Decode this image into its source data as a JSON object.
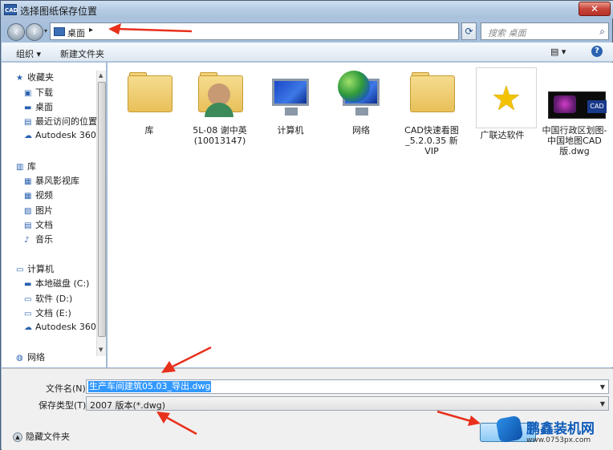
{
  "window": {
    "title": "选择图纸保存位置",
    "app_badge": "CAD",
    "close_label": "✕"
  },
  "address_bar": {
    "location": "桌面",
    "chevron": "▸",
    "search_placeholder": "搜索 桌面"
  },
  "toolbar": {
    "organize_label": "组织 ▾",
    "new_folder_label": "新建文件夹",
    "view_label": "▤ ▾",
    "help_label": "?"
  },
  "nav_pane": {
    "favorites": {
      "label": "收藏夹",
      "items": [
        "下载",
        "桌面",
        "最近访问的位置",
        "Autodesk 360"
      ]
    },
    "libraries": {
      "label": "库",
      "items": [
        "暴风影视库",
        "视频",
        "图片",
        "文档",
        "音乐"
      ]
    },
    "computer": {
      "label": "计算机",
      "items": [
        "本地磁盘 (C:)",
        "软件 (D:)",
        "文档 (E:)",
        "Autodesk 360"
      ]
    },
    "network": {
      "label": "网络"
    }
  },
  "files": [
    {
      "name": "库",
      "icon": "library-folder-icon"
    },
    {
      "name": "5L-08 谢中英 (10013147)",
      "icon": "user-folder-icon"
    },
    {
      "name": "计算机",
      "icon": "computer-icon"
    },
    {
      "name": "网络",
      "icon": "network-icon"
    },
    {
      "name": "CAD快速看图_5.2.0.35 新 VIP",
      "icon": "folder-icon"
    },
    {
      "name": "广联达软件",
      "icon": "star-shortcut-icon"
    },
    {
      "name": "中国行政区划图-中国地图CAD版.dwg",
      "icon": "dwg-thumbnail-icon"
    }
  ],
  "thumb_badge": "CAD",
  "form": {
    "filename_label": "文件名(N):",
    "filename_value": "生产车间建筑05.03_导出.dwg",
    "filetype_label": "保存类型(T):",
    "filetype_value": "2007 版本(*.dwg)"
  },
  "hide_folders_label": "隐藏文件夹",
  "watermark": {
    "text": "鹏鑫装机网",
    "url": "www.0753px.com"
  },
  "colors": {
    "accent": "#3399ff",
    "arrow": "#e8301c"
  }
}
